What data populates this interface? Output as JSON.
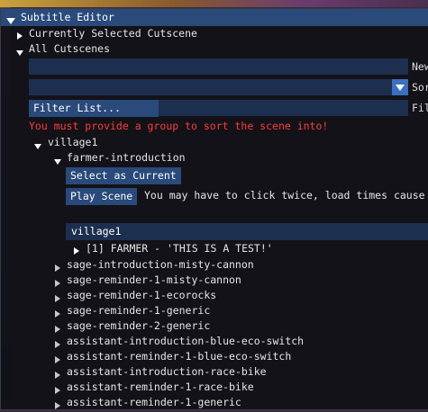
{
  "window": {
    "title": "Subtitle Editor"
  },
  "tree": {
    "currently_selected": "Currently Selected Cutscene",
    "all_cutscenes": "All Cutscenes"
  },
  "controls": {
    "new_input_value": "",
    "new_label": "New",
    "sort_combo_value": "",
    "sort_label": "Sort",
    "filter_button": "Filter List...",
    "filter_label": "Fil"
  },
  "error_message": "You must provide a group to sort the scene into!",
  "group": {
    "name": "village1",
    "expanded_scene": "farmer-introduction",
    "select_button": "Select as Current",
    "play_button": "Play Scene",
    "play_hint": "You may have to click twice, load times cause",
    "group_field_value": "village1",
    "subtitle_line": "[1] FARMER - 'THIS IS A TEST!'"
  },
  "scenes": [
    "sage-introduction-misty-cannon",
    "sage-reminder-1-misty-cannon",
    "sage-reminder-1-ecorocks",
    "sage-reminder-1-generic",
    "sage-reminder-2-generic",
    "assistant-introduction-blue-eco-switch",
    "assistant-reminder-1-blue-eco-switch",
    "assistant-introduction-race-bike",
    "assistant-reminder-1-race-bike",
    "assistant-reminder-1-generic"
  ]
}
